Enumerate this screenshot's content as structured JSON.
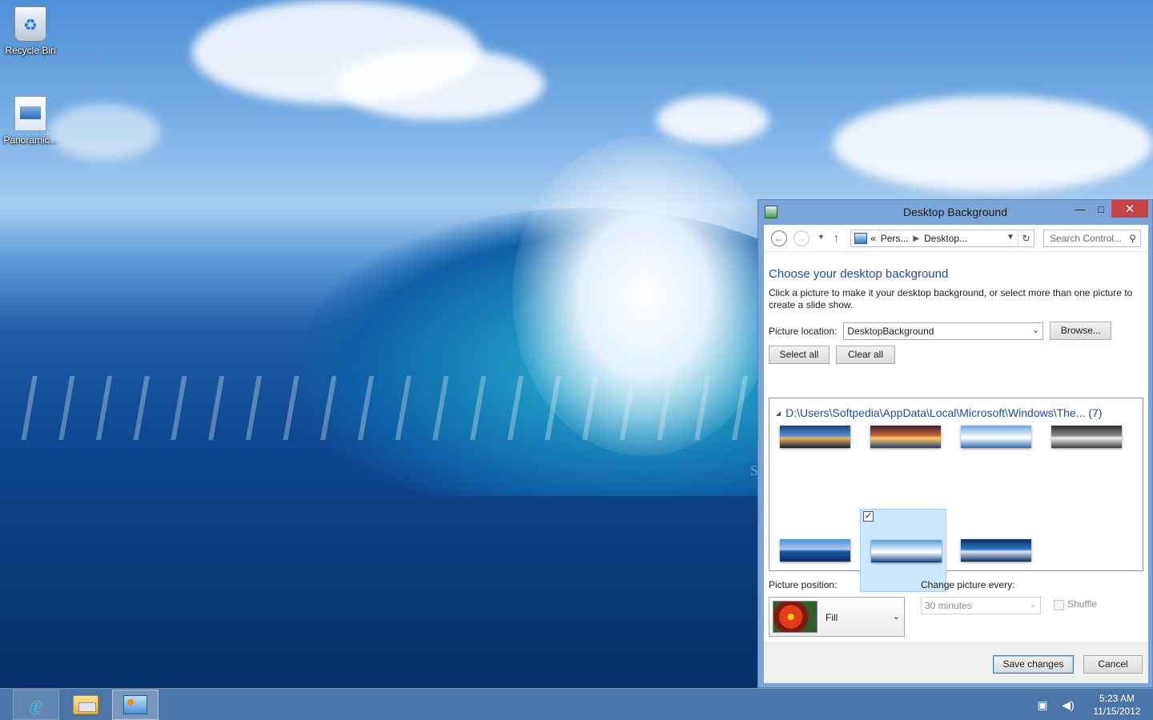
{
  "desktop": {
    "icons": [
      {
        "label": "Recycle Bin"
      },
      {
        "label": "Panoramic..."
      }
    ],
    "watermark": "SOFTPEDIA"
  },
  "taskbar": {
    "clock_time": "5:23 AM",
    "clock_date": "11/15/2012"
  },
  "window": {
    "title": "Desktop Background",
    "controls": {
      "minimize": "—",
      "maximize": "□",
      "close": "✕"
    },
    "address": {
      "prefix": "«",
      "segments": [
        "Pers...",
        "Desktop..."
      ]
    },
    "search_placeholder": "Search Control...",
    "heading": "Choose your desktop background",
    "description": "Click a picture to make it your desktop background, or select more than one picture to create a slide show.",
    "picture_location_label": "Picture location:",
    "picture_location_value": "DesktopBackground",
    "browse_label": "Browse...",
    "select_all_label": "Select all",
    "clear_all_label": "Clear all",
    "group_title": "D:\\Users\\Softpedia\\AppData\\Local\\Microsoft\\Windows\\The... (7)",
    "thumbnails": [
      {
        "name": "coastal-sunset",
        "selected": false,
        "colors": [
          "#1b3f7a",
          "#4f8fd1",
          "#f2b04f",
          "#0d2345"
        ]
      },
      {
        "name": "ocean-sunrise",
        "selected": false,
        "colors": [
          "#3a1c3a",
          "#c96a2a",
          "#ffcf6a",
          "#233b7a"
        ]
      },
      {
        "name": "white-surf",
        "selected": false,
        "colors": [
          "#6da4dc",
          "#e9f3fb",
          "#ffffff",
          "#2e6db7"
        ]
      },
      {
        "name": "silver-sea",
        "selected": false,
        "colors": [
          "#2b2b2b",
          "#8d8d8d",
          "#f1f1f1",
          "#3b3b3b"
        ]
      },
      {
        "name": "deep-blue-swell",
        "selected": false,
        "colors": [
          "#4f8fd6",
          "#a9cdf1",
          "#1b57a2",
          "#0b2f66"
        ]
      },
      {
        "name": "breaking-wave",
        "selected": true,
        "colors": [
          "#5b9ae0",
          "#e6f1fb",
          "#ffffff",
          "#0d3f86"
        ]
      },
      {
        "name": "curl-tube",
        "selected": false,
        "colors": [
          "#0b2f66",
          "#2e77c8",
          "#dcecf9",
          "#0a2c5e"
        ]
      }
    ],
    "picture_position_label": "Picture position:",
    "picture_position_value": "Fill",
    "change_picture_label": "Change picture every:",
    "change_picture_value": "30 minutes",
    "shuffle_label": "Shuffle",
    "save_label": "Save changes",
    "cancel_label": "Cancel"
  }
}
